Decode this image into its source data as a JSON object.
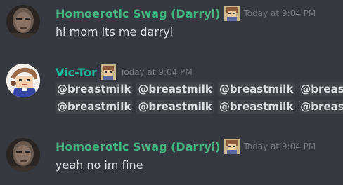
{
  "messages": [
    {
      "author": "Homoerotic Swag (Darryl)",
      "author_color": "#43b581",
      "timestamp": "Today at 9:04 PM",
      "text": "hi mom its me darryl",
      "avatar_icon": "dark-face-avatar"
    },
    {
      "author": "Vic-Tor",
      "author_color": "#1abc9c",
      "timestamp": "Today at 9:04 PM",
      "avatar_icon": "cartoon-character-avatar",
      "mention_lines": [
        [
          "@breastmilk",
          "@breastmilk",
          "@breastmilk",
          "@breas"
        ],
        [
          "@breastmilk",
          "@breastmilk",
          "@breastmilk",
          "@breas"
        ]
      ]
    },
    {
      "author": "Homoerotic Swag (Darryl)",
      "author_color": "#43b581",
      "timestamp": "Today at 9:04 PM",
      "text": "yeah no im fine",
      "avatar_icon": "dark-face-avatar"
    }
  ]
}
